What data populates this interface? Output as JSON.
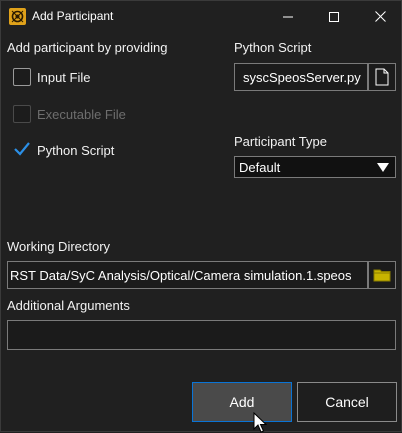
{
  "window": {
    "title": "Add Participant",
    "icon": "ansys-app-icon",
    "controls": [
      "minimize-icon",
      "maximize-icon",
      "close-icon"
    ]
  },
  "provide_group": {
    "heading": "Add participant by providing",
    "options": [
      {
        "label": "Input File",
        "checked": false,
        "enabled": true
      },
      {
        "label": "Executable File",
        "checked": false,
        "enabled": false
      },
      {
        "label": "Python Script",
        "checked": true,
        "enabled": true
      }
    ]
  },
  "python_script": {
    "label": "Python Script",
    "value": "syscSpeosServer.py",
    "browse_icon": "file-icon"
  },
  "participant_type": {
    "label": "Participant Type",
    "selected": "Default"
  },
  "working_directory": {
    "label": "Working Directory",
    "value": "RST Data/SyC Analysis/Optical/Camera simulation.1.speos",
    "browse_icon": "folder-icon"
  },
  "additional_arguments": {
    "label": "Additional Arguments",
    "value": ""
  },
  "buttons": {
    "add": "Add",
    "cancel": "Cancel"
  },
  "colors": {
    "background": "#202020",
    "accent": "#0a74d6",
    "checkbox_checked": "#2b8fe6",
    "folder": "#c8b400"
  }
}
